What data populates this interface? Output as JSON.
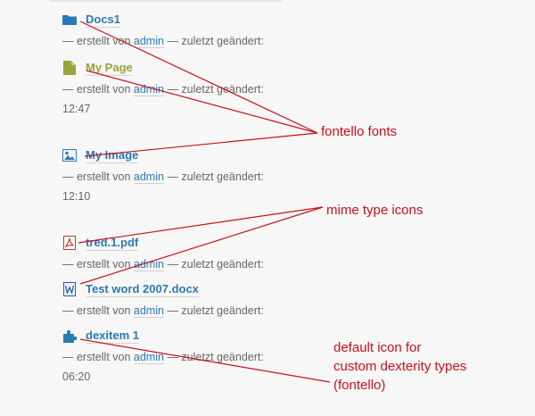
{
  "items": [
    {
      "title": "Docs1",
      "icon": "folder-icon",
      "meta_prefix": "— erstellt von",
      "author": "admin",
      "meta_suffix": "— zuletzt geändert:",
      "time": ""
    },
    {
      "title": "My Page",
      "icon": "document-icon",
      "meta_prefix": "— erstellt von",
      "author": "admin",
      "meta_suffix": "— zuletzt geändert:",
      "time": "12:47"
    },
    {
      "title": "My Image",
      "icon": "image-icon",
      "meta_prefix": "— erstellt von",
      "author": "admin",
      "meta_suffix": "— zuletzt geändert:",
      "time": "12:10"
    },
    {
      "title": "tred.1.pdf",
      "icon": "pdf-icon",
      "meta_prefix": "— erstellt von",
      "author": "admin",
      "meta_suffix": "— zuletzt geändert:",
      "time": ""
    },
    {
      "title": "Test word 2007.docx",
      "icon": "word-document-icon",
      "meta_prefix": "— erstellt von",
      "author": "admin",
      "meta_suffix": "— zuletzt geändert:",
      "time": ""
    },
    {
      "title": "dexitem 1",
      "icon": "puzzle-icon",
      "meta_prefix": "— erstellt von",
      "author": "admin",
      "meta_suffix": "— zuletzt geändert:",
      "time": "06:20"
    }
  ],
  "annotations": {
    "fontello": "fontello fonts",
    "mime": "mime type icons",
    "default_line1": "default icon for",
    "default_line2": "custom dexterity types",
    "default_line3": "(fontello)"
  },
  "colors": {
    "link": "#2a7ab5",
    "olive": "#9aa33a",
    "annotation": "#c8101a",
    "meta_text": "#666666"
  }
}
